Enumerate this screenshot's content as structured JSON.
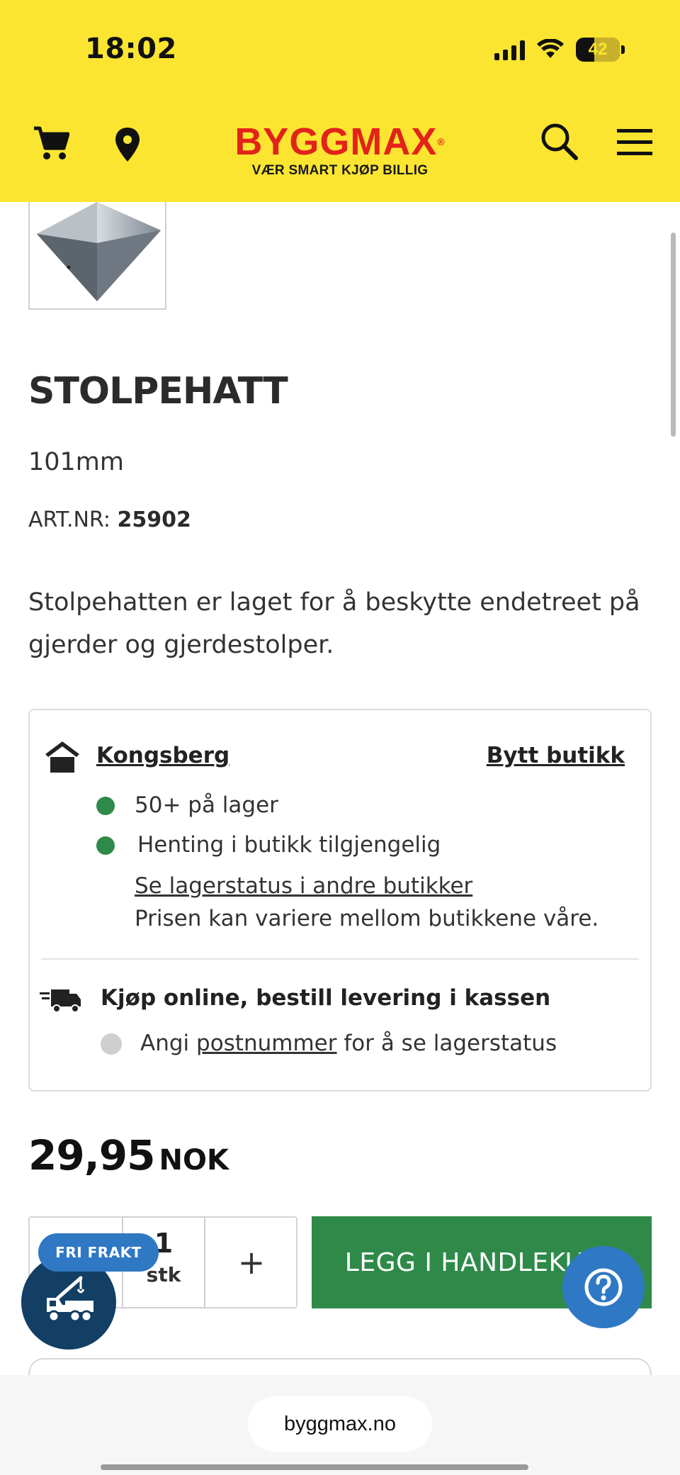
{
  "status": {
    "time": "18:02",
    "battery": "42"
  },
  "header": {
    "logo_text": "BYGGMAX",
    "tagline": "VÆR SMART KJØP BILLIG",
    "icons": [
      "cart-icon",
      "location-pin-icon",
      "search-icon",
      "menu-icon"
    ]
  },
  "product": {
    "title": "STOLPEHATT",
    "size": "101mm",
    "art_label": "ART.NR:",
    "art_number": "25902",
    "description": "Stolpehatten er laget for å beskytte endetreet på gjerder og gjerdestolper."
  },
  "stock": {
    "store_name": "Kongsberg",
    "change_store": "Bytt butikk",
    "in_stock": "50+ på lager",
    "pickup": "Henting i butikk tilgjengelig",
    "other_stores_link": "Se lagerstatus i andre butikker",
    "price_note": "Prisen kan variere mellom butikkene våre.",
    "delivery_title": "Kjøp online, bestill levering i kassen",
    "postcode_prefix": "Angi",
    "postcode_link": "postnummer",
    "postcode_suffix": "for å se lagerstatus",
    "colors": {
      "available": "#2f8a4a",
      "unknown": "#cfcfcf"
    }
  },
  "price": {
    "amount": "29,95",
    "currency": "NOK"
  },
  "quantity": {
    "value": "1",
    "unit": "stk",
    "plus": "+"
  },
  "add_to_cart": "LEGG I HANDLEKURV",
  "free_shipping_badge": "FRI FRAKT",
  "browser": {
    "url": "byggmax.no"
  },
  "theme": {
    "header_bg": "#fbe531",
    "brand_red": "#e2231a",
    "green": "#2f8a4a",
    "blue": "#2f78c4",
    "navy": "#123f63"
  }
}
